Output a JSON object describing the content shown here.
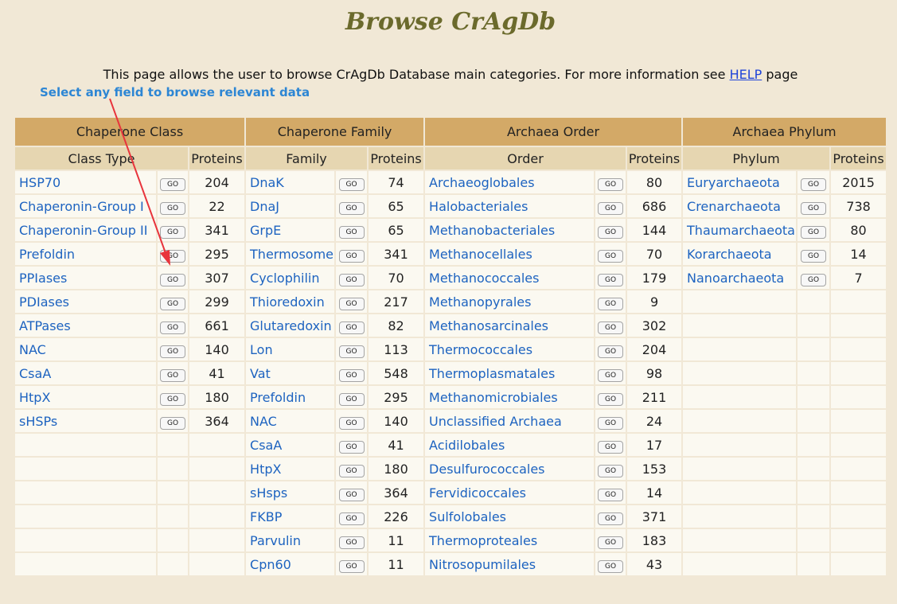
{
  "page": {
    "title": "Browse CrAgDb",
    "intro_text": "This page allows the user to browse CrAgDb Database main categories. For more information see ",
    "help_link": "HELP",
    "intro_suffix": " page",
    "annotation": "Select any field to browse relevant data",
    "go_label": "GO"
  },
  "headers": {
    "groups": [
      "Chaperone Class",
      "Chaperone Family",
      "Archaea Order",
      "Archaea Phylum"
    ],
    "class_type": "Class Type",
    "family": "Family",
    "order": "Order",
    "phylum": "Phylum",
    "proteins": "Proteins"
  },
  "class_rows": [
    {
      "name": "HSP70",
      "proteins": "204"
    },
    {
      "name": "Chaperonin-Group I",
      "proteins": "22"
    },
    {
      "name": "Chaperonin-Group II",
      "proteins": "341"
    },
    {
      "name": "Prefoldin",
      "proteins": "295"
    },
    {
      "name": "PPIases",
      "proteins": "307"
    },
    {
      "name": "PDIases",
      "proteins": "299"
    },
    {
      "name": "ATPases",
      "proteins": "661"
    },
    {
      "name": "NAC",
      "proteins": "140"
    },
    {
      "name": "CsaA",
      "proteins": "41"
    },
    {
      "name": "HtpX",
      "proteins": "180"
    },
    {
      "name": "sHSPs",
      "proteins": "364"
    }
  ],
  "family_rows": [
    {
      "name": "DnaK",
      "proteins": "74"
    },
    {
      "name": "DnaJ",
      "proteins": "65"
    },
    {
      "name": "GrpE",
      "proteins": "65"
    },
    {
      "name": "Thermosome",
      "proteins": "341"
    },
    {
      "name": "Cyclophilin",
      "proteins": "70"
    },
    {
      "name": "Thioredoxin",
      "proteins": "217"
    },
    {
      "name": "Glutaredoxin",
      "proteins": "82"
    },
    {
      "name": "Lon",
      "proteins": "113"
    },
    {
      "name": "Vat",
      "proteins": "548"
    },
    {
      "name": "Prefoldin",
      "proteins": "295"
    },
    {
      "name": "NAC",
      "proteins": "140"
    },
    {
      "name": "CsaA",
      "proteins": "41"
    },
    {
      "name": "HtpX",
      "proteins": "180"
    },
    {
      "name": "sHsps",
      "proteins": "364"
    },
    {
      "name": "FKBP",
      "proteins": "226"
    },
    {
      "name": "Parvulin",
      "proteins": "11"
    },
    {
      "name": "Cpn60",
      "proteins": "11"
    }
  ],
  "order_rows": [
    {
      "name": "Archaeoglobales",
      "proteins": "80"
    },
    {
      "name": "Halobacteriales",
      "proteins": "686"
    },
    {
      "name": "Methanobacteriales",
      "proteins": "144"
    },
    {
      "name": "Methanocellales",
      "proteins": "70"
    },
    {
      "name": "Methanococcales",
      "proteins": "179"
    },
    {
      "name": "Methanopyrales",
      "proteins": "9"
    },
    {
      "name": "Methanosarcinales",
      "proteins": "302"
    },
    {
      "name": "Thermococcales",
      "proteins": "204"
    },
    {
      "name": "Thermoplasmatales",
      "proteins": "98"
    },
    {
      "name": "Methanomicrobiales",
      "proteins": "211"
    },
    {
      "name": "Unclassified Archaea",
      "proteins": "24"
    },
    {
      "name": "Acidilobales",
      "proteins": "17"
    },
    {
      "name": "Desulfurococcales",
      "proteins": "153"
    },
    {
      "name": "Fervidicoccales",
      "proteins": "14"
    },
    {
      "name": "Sulfolobales",
      "proteins": "371"
    },
    {
      "name": "Thermoproteales",
      "proteins": "183"
    },
    {
      "name": "Nitrosopumilales",
      "proteins": "43"
    }
  ],
  "phylum_rows": [
    {
      "name": "Euryarchaeota",
      "proteins": "2015"
    },
    {
      "name": "Crenarchaeota",
      "proteins": "738"
    },
    {
      "name": "Thaumarchaeota",
      "proteins": "80"
    },
    {
      "name": "Korarchaeota",
      "proteins": "14"
    },
    {
      "name": "Nanoarchaeota",
      "proteins": "7"
    }
  ],
  "colors": {
    "background": "#f1e8d6",
    "header_dark": "#d3a967",
    "header_light": "#e6d6b1",
    "link": "#1d63c0",
    "annotation": "#2d86d4",
    "arrow": "#e8343c"
  }
}
